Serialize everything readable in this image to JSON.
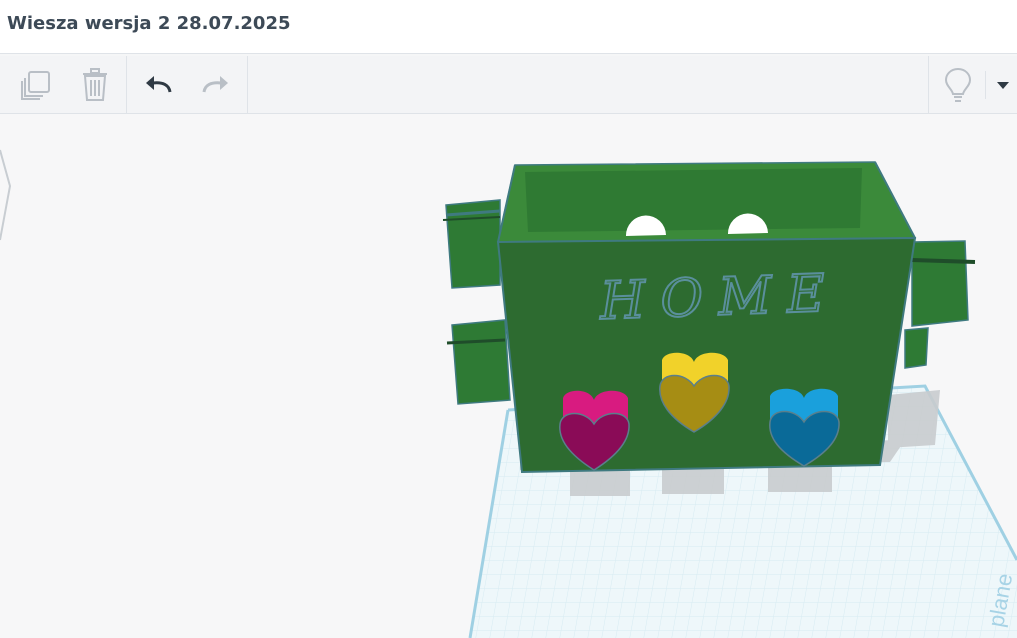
{
  "document": {
    "title": "Wiesza wersja 2 28.07.2025"
  },
  "toolbar": {
    "copy_icon": "duplicate-icon",
    "delete_icon": "trash-icon",
    "undo_icon": "undo-icon",
    "redo_icon": "redo-icon",
    "hint_icon": "lightbulb-icon",
    "menu_icon": "caret-down-icon"
  },
  "viewport": {
    "embossed_text": "HOME",
    "workplane_text": "plane",
    "colors": {
      "box": "#2e6b31",
      "box_edge": "#3f7a80",
      "heart_magenta": "#c2187a",
      "heart_yellow": "#e8c81c",
      "heart_blue": "#1390c8",
      "grid": "#cfe7ef"
    }
  }
}
